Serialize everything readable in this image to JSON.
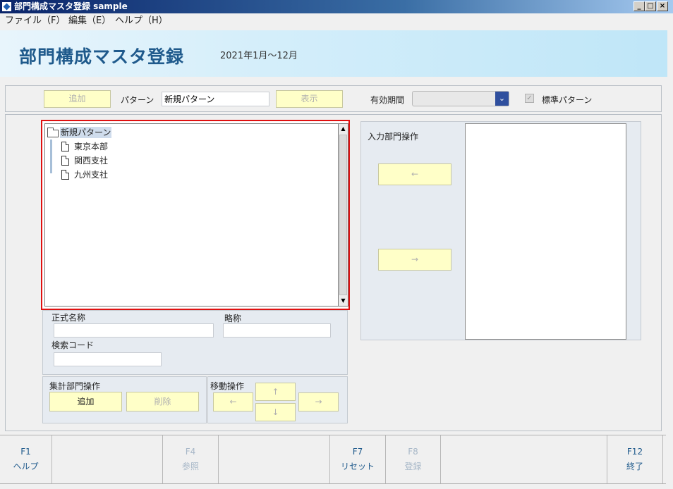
{
  "window": {
    "title": "部門構成マスタ登録 sample",
    "min": "_",
    "max": "□",
    "close": "×"
  },
  "menu": [
    "ファイル（F）",
    "編集（E）",
    "ヘルプ（H）"
  ],
  "header": {
    "title": "部門構成マスタ登録",
    "period": "2021年1月～12月"
  },
  "toolbar": {
    "add": "追加",
    "pattern_label": "パターン",
    "pattern_value": "新規パターン",
    "show": "表示",
    "valid_label": "有効期間",
    "valid_value": "",
    "standard_label": "標準パターン"
  },
  "tree": {
    "root": "新規パターン",
    "children": [
      "東京本部",
      "関西支社",
      "九州支社"
    ]
  },
  "details": {
    "official_label": "正式名称",
    "official_value": "",
    "abbr_label": "略称",
    "abbr_value": "",
    "search_label": "検索コード",
    "search_value": ""
  },
  "aggregate": {
    "title": "集計部門操作",
    "add": "追加",
    "delete": "削除"
  },
  "move": {
    "title": "移動操作",
    "left": "←",
    "up": "↑",
    "down": "↓",
    "right": "→"
  },
  "input_dept": {
    "title": "入力部門操作",
    "left": "←",
    "right": "→"
  },
  "fkeys": [
    {
      "key": "F1",
      "name": "ヘルプ"
    },
    {
      "key": "F4",
      "name": "参照"
    },
    {
      "key": "F7",
      "name": "リセット"
    },
    {
      "key": "F8",
      "name": "登録"
    },
    {
      "key": "F12",
      "name": "終了"
    }
  ]
}
